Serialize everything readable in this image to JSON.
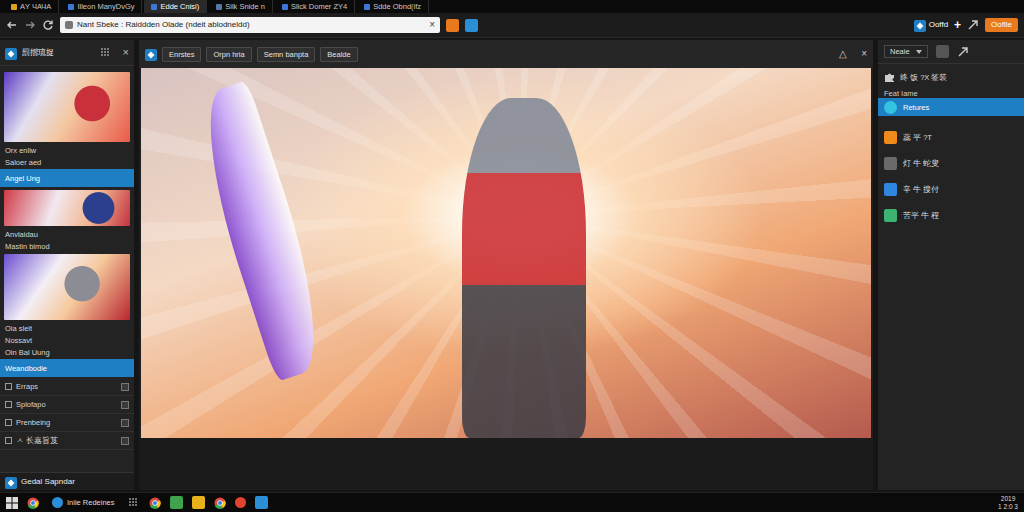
{
  "browser": {
    "tabs": [
      {
        "label": "АΥ ЧАЧА",
        "selected": false,
        "color": "#e0a020"
      },
      {
        "label": "Illeon ManyDvGy",
        "selected": false,
        "color": "#3b78d8"
      },
      {
        "label": "Edde Cnisi)",
        "selected": true,
        "color": "#3b78d8"
      },
      {
        "label": "Silk Snide n",
        "selected": false,
        "color": "#5577aa"
      },
      {
        "label": "Slick Domer ZY4",
        "selected": false,
        "color": "#3b78d8"
      },
      {
        "label": "Sdde Obnd(ifz",
        "selected": false,
        "color": "#3b78d8"
      }
    ],
    "address": "Nant Sbeke : Raiddden Olade (ndeit ablodneldd)",
    "address_close": "×",
    "account": "Ooffd",
    "plus": "+",
    "action": "Ooflle"
  },
  "sidebar": {
    "title": "罰摺琉捉",
    "close": "×",
    "items": [
      {
        "kind": "thumb",
        "selected": false
      },
      {
        "kind": "label",
        "text": "Orx enliw",
        "selected": false
      },
      {
        "kind": "label",
        "text": "Saloer aed",
        "selected": false
      },
      {
        "kind": "label",
        "text": "Angel Ung",
        "selected": true
      },
      {
        "kind": "thumb",
        "selected": false
      },
      {
        "kind": "label",
        "text": "Anvlaidau",
        "selected": false
      },
      {
        "kind": "label",
        "text": "Mastin bimod",
        "selected": false
      },
      {
        "kind": "thumb",
        "selected": false
      },
      {
        "kind": "label",
        "text": "Oia sleit",
        "selected": false
      },
      {
        "kind": "label",
        "text": "Nossavt",
        "selected": false
      },
      {
        "kind": "label",
        "text": "Oin Bal Uung",
        "selected": false
      },
      {
        "kind": "label",
        "text": "Weandbodie",
        "selected": true
      },
      {
        "kind": "option",
        "text": "Erraps",
        "selected": false
      },
      {
        "kind": "option",
        "text": "Splofapo",
        "selected": false
      },
      {
        "kind": "option",
        "text": "Prenbeing",
        "selected": false
      },
      {
        "kind": "option",
        "text": "ㅅ 长嘉旨芨",
        "selected": false
      }
    ],
    "footer": "Gedal Sapndar"
  },
  "toolbar": {
    "buttons": [
      "Enrstes",
      "Orpn hria",
      "Semn banpta",
      "Bealde"
    ],
    "sort": "△",
    "close": "×"
  },
  "panel": {
    "dropdown": "Neaie",
    "heading": "终 饭 ?X 签装",
    "subheading": "Feat Iame",
    "items": [
      {
        "label": "Retures",
        "selected": true,
        "color": "#36c3e0"
      },
      {
        "label": "蕊 平 ?T",
        "selected": false,
        "color": "#f08a1c"
      },
      {
        "label": "灯 牛 蛇叟",
        "selected": false,
        "color": "#6a6a6a"
      },
      {
        "label": "辛 牛 搜付",
        "selected": false,
        "color": "#2e86de"
      },
      {
        "label": "苦平 牛 程",
        "selected": false,
        "color": "#3cb371"
      }
    ]
  },
  "taskbar": {
    "app": "Iniie Redeines",
    "time": "2019",
    "date": "1 2:0 3"
  }
}
